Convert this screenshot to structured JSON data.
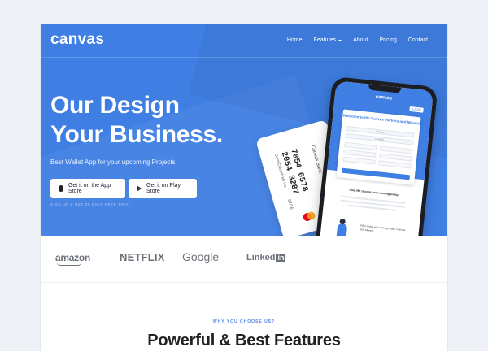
{
  "brand": "canvas",
  "nav": {
    "items": [
      {
        "label": "Home"
      },
      {
        "label": "Features"
      },
      {
        "label": "About"
      },
      {
        "label": "Pricing"
      },
      {
        "label": "Contact"
      }
    ]
  },
  "hero": {
    "headline_line1": "Our Design",
    "headline_line2": "Your Business.",
    "tagline": "Best Wallet App for your upcoming Projects.",
    "app_store_label": "Get it on the App Store",
    "play_store_label": "Get it on Play Store",
    "note": "Sign up & get 30 days free trial"
  },
  "card": {
    "bank": "Canvas Bank",
    "number_line1": "7854 0578",
    "number_line2": "2054 3287",
    "holder": "SemiColonWeb Inc",
    "expiry": "07/16"
  },
  "phone": {
    "brand": "canvas",
    "login_label": "LOGIN",
    "form_title": "Welcome to the Canvas Packers and Movers",
    "field_from": "Location",
    "field_to": "Location",
    "heading": "Help Me choose your moving today",
    "side_text": "Who chose your moving today. Canvas 100 Movers"
  },
  "logos": {
    "amazon": "amazon",
    "netflix": "NETFLIX",
    "google": "Google",
    "linkedin_text": "Linked",
    "linkedin_box": "in"
  },
  "features": {
    "eyebrow": "WHY YOU CHOOSE US?",
    "title": "Powerful & Best Features"
  },
  "colors": {
    "accent": "#3f7ee2",
    "text_dark": "#222222",
    "logo_gray": "#6c7079"
  }
}
